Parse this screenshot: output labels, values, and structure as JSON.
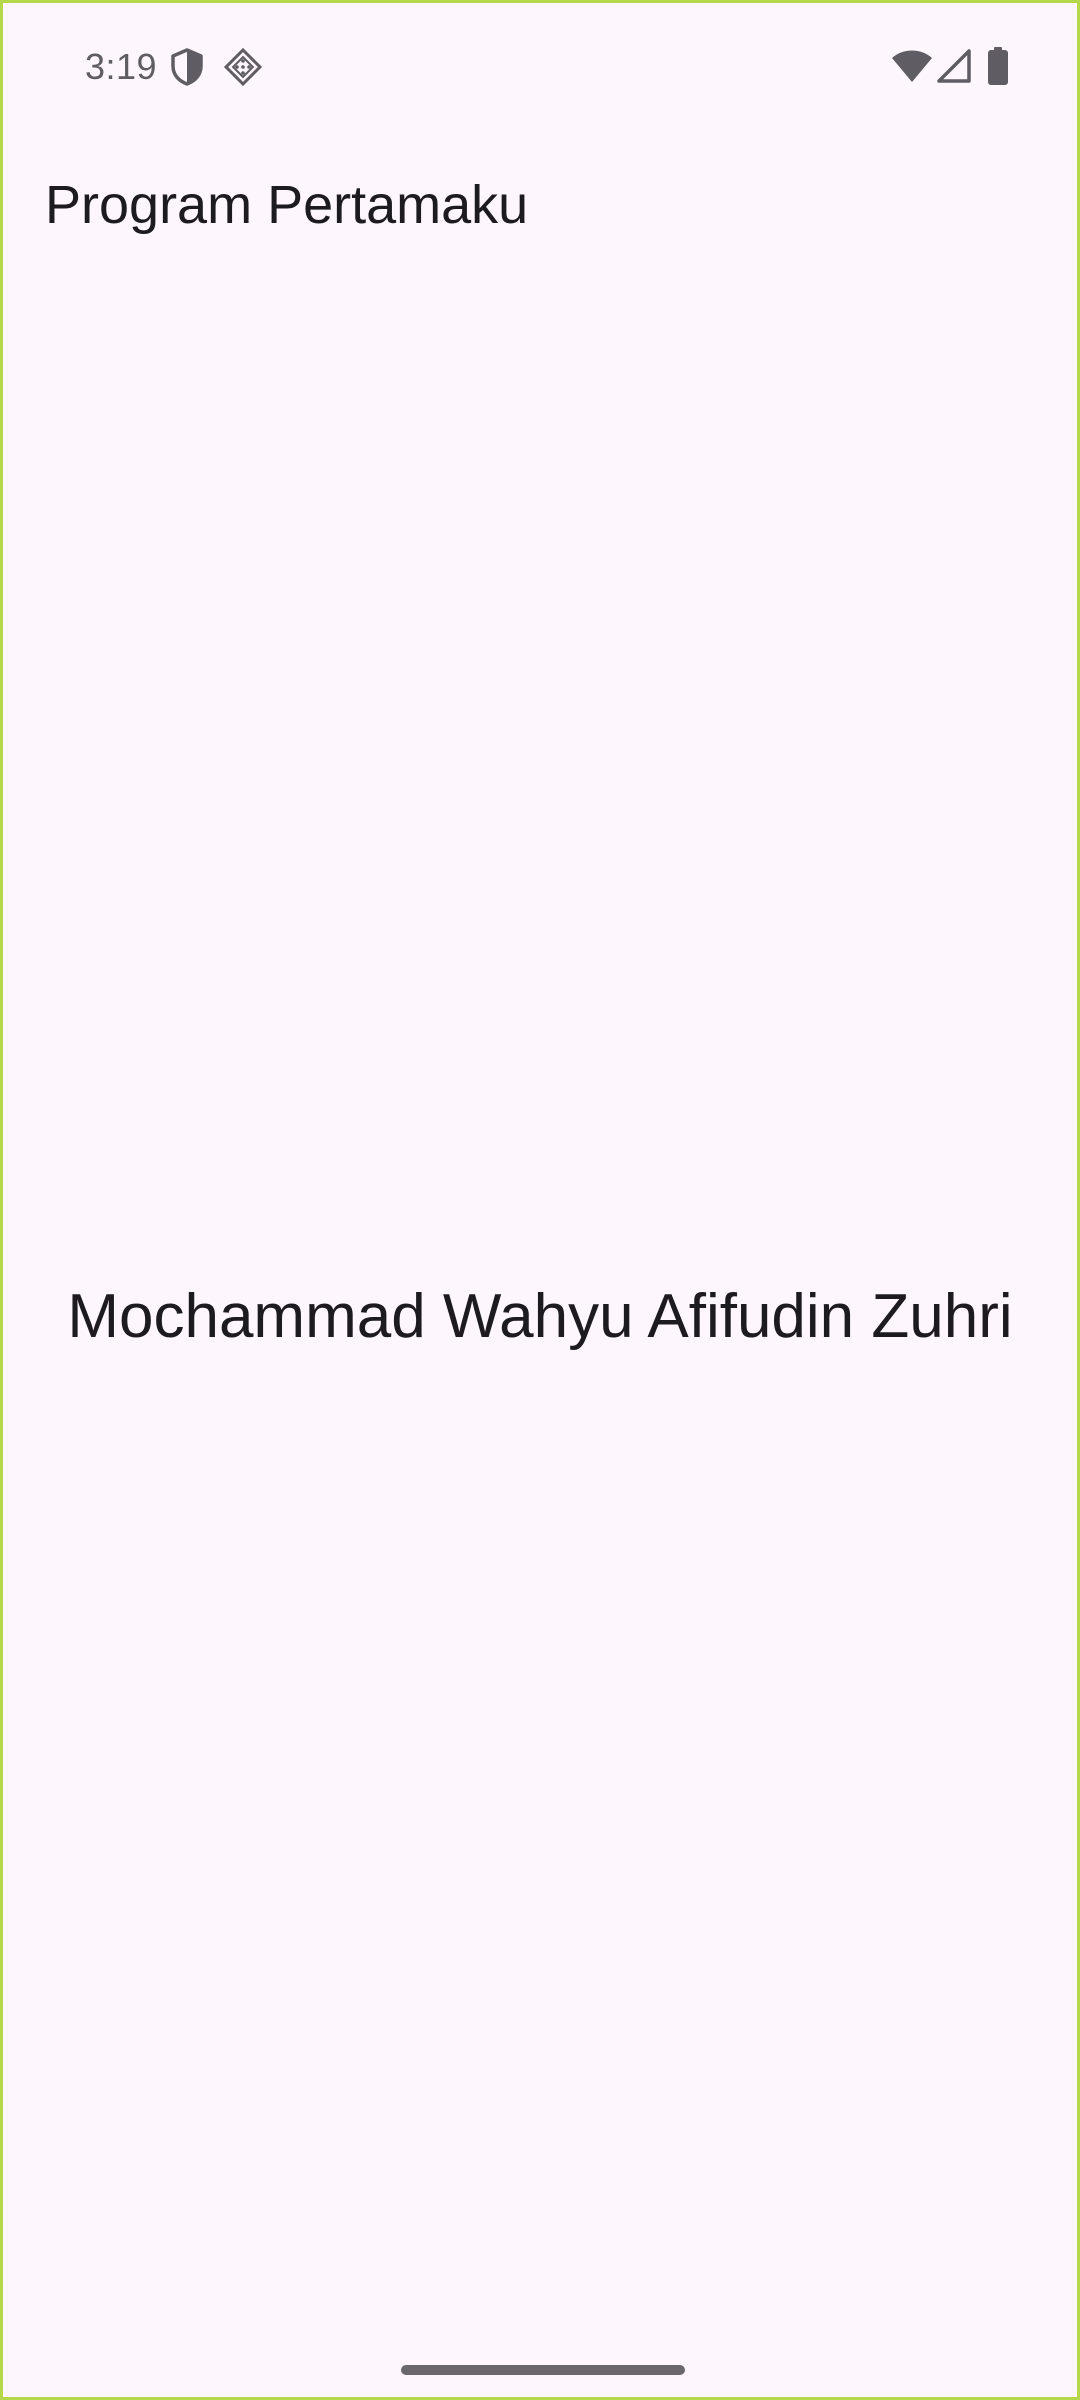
{
  "status_bar": {
    "time": "3:19",
    "left_icons": [
      "shield-icon",
      "diamond-icon"
    ],
    "right_icons": [
      "wifi-icon",
      "signal-icon",
      "battery-icon"
    ]
  },
  "app_bar": {
    "title": "Program Pertamaku"
  },
  "body": {
    "text": "Mochammad Wahyu Afifudin Zuhri"
  },
  "colors": {
    "background": "#fdf7fd",
    "text": "#1d1b20",
    "status_icons": "#5f5c63",
    "frame_border": "#b5d84a",
    "nav_handle": "#6a686d"
  }
}
